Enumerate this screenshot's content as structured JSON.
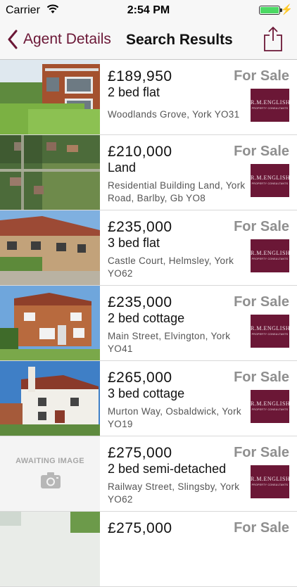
{
  "status_bar": {
    "carrier": "Carrier",
    "time": "2:54 PM"
  },
  "nav": {
    "back_label": "Agent Details",
    "title": "Search Results"
  },
  "listings": [
    {
      "price": "£189,950",
      "type": "2 bed flat",
      "address": "Woodlands Grove, York YO31",
      "status": "For Sale",
      "thumbnail": "brick-flats-photo"
    },
    {
      "price": "£210,000",
      "type": "Land",
      "address": "Residential Building Land, York Road, Barlby, Gb YO8",
      "status": "For Sale",
      "thumbnail": "aerial-land-photo"
    },
    {
      "price": "£235,000",
      "type": "3 bed flat",
      "address": "Castle Court, Helmsley, York YO62",
      "status": "For Sale",
      "thumbnail": "stone-terrace-photo"
    },
    {
      "price": "£235,000",
      "type": "2 bed cottage",
      "address": "Main Street, Elvington, York YO41",
      "status": "For Sale",
      "thumbnail": "brick-cottage-photo"
    },
    {
      "price": "£265,000",
      "type": "3 bed cottage",
      "address": "Murton Way, Osbaldwick, York YO19",
      "status": "For Sale",
      "thumbnail": "white-cottage-photo"
    },
    {
      "price": "£275,000",
      "type": "2 bed semi-detached",
      "address": "Railway Street, Slingsby, York YO62",
      "status": "For Sale",
      "awaiting_text": "AWAITING IMAGE",
      "thumbnail": "camera-icon"
    },
    {
      "price": "£275,000",
      "type": "",
      "address": "",
      "status": "For Sale",
      "thumbnail": "partial-photo"
    }
  ],
  "agent_logo": {
    "line1": "R.M.ENGLISH",
    "line2": "PROPERTY CONSULTANTS",
    "color": "#6b1736"
  },
  "colors": {
    "accent": "#6b1736",
    "status_text": "#8f8f8f",
    "battery": "#4cd964"
  }
}
